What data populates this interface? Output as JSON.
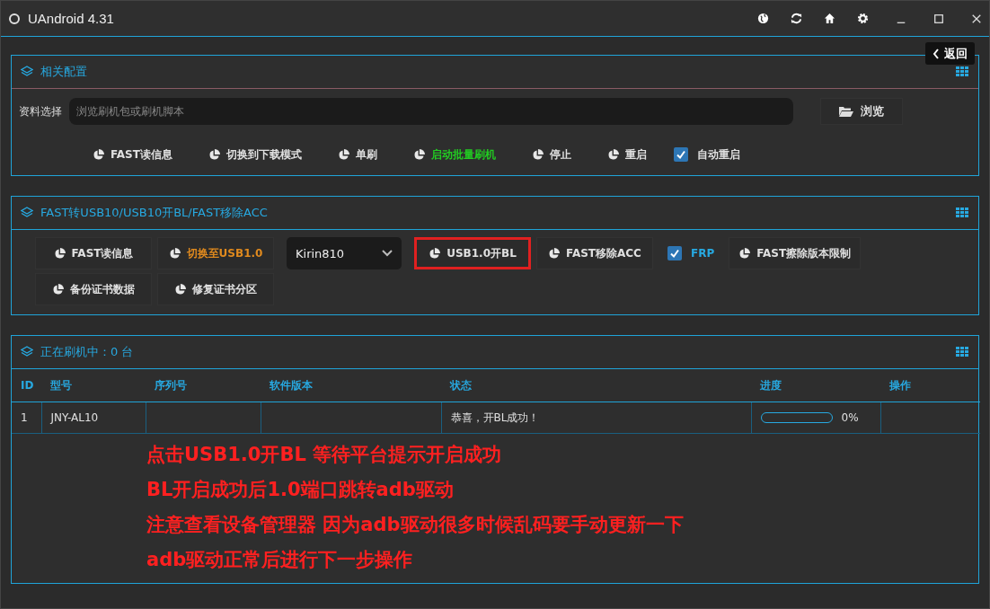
{
  "window": {
    "title": "UAndroid 4.31"
  },
  "back_button": {
    "label": "返回"
  },
  "config_panel": {
    "title": "相关配置",
    "file_label": "资料选择",
    "file_field": {
      "placeholder": "浏览刷机包或刷机脚本"
    },
    "browse_button": "浏览",
    "actions": [
      {
        "kind": "button",
        "label": "FAST读信息",
        "color": "#e0e0e0"
      },
      {
        "kind": "button",
        "label": "切换到下载模式",
        "color": "#e0e0e0"
      },
      {
        "kind": "button",
        "label": "单刷",
        "color": "#e0e0e0"
      },
      {
        "kind": "button",
        "label": "启动批量刷机",
        "color": "#22cc22"
      },
      {
        "kind": "button",
        "label": "停止",
        "color": "#e0e0e0"
      },
      {
        "kind": "button",
        "label": "重启",
        "color": "#e0e0e0"
      },
      {
        "kind": "checkbox",
        "label": "自动重启",
        "checked": true
      }
    ]
  },
  "fast_panel": {
    "title": "FAST转USB10/USB10开BL/FAST移除ACC",
    "rows": [
      [
        {
          "kind": "button",
          "label": "FAST读信息",
          "color": "#e0e0e0",
          "highlighted": false
        },
        {
          "kind": "button",
          "label": "切换至USB1.0",
          "color": "#e08a1e",
          "highlighted": false
        },
        {
          "kind": "select",
          "value": "Kirin810"
        },
        {
          "kind": "button",
          "label": "USB1.0开BL",
          "color": "#e0e0e0",
          "highlighted": true
        },
        {
          "kind": "button",
          "label": "FAST移除ACC",
          "color": "#e0e0e0",
          "highlighted": false
        },
        {
          "kind": "checkbox",
          "label": "FRP",
          "checked": true
        },
        {
          "kind": "button",
          "label": "FAST擦除版本限制",
          "color": "#e0e0e0",
          "highlighted": false
        }
      ],
      [
        {
          "kind": "button",
          "label": "备份证书数据",
          "color": "#e0e0e0",
          "highlighted": false
        },
        {
          "kind": "button",
          "label": "修复证书分区",
          "color": "#e0e0e0",
          "highlighted": false
        }
      ]
    ]
  },
  "flash_panel": {
    "title": "正在刷机中：0 台",
    "table": {
      "columns": [
        "ID",
        "型号",
        "序列号",
        "软件版本",
        "状态",
        "进度",
        "操作"
      ],
      "rows": [
        {
          "id": "1",
          "model": "JNY-AL10",
          "serial": "",
          "version": "",
          "status": "恭喜，开BL成功！",
          "progress": {
            "level": 0,
            "reading": "0%"
          },
          "action": ""
        }
      ]
    },
    "notes": [
      "点击USB1.0开BL 等待平台提示开启成功",
      "BL开启成功后1.0端口跳转adb驱动",
      "注意查看设备管理器 因为adb驱动很多时候乱码要手动更新一下",
      "adb驱动正常后进行下一步操作"
    ]
  }
}
